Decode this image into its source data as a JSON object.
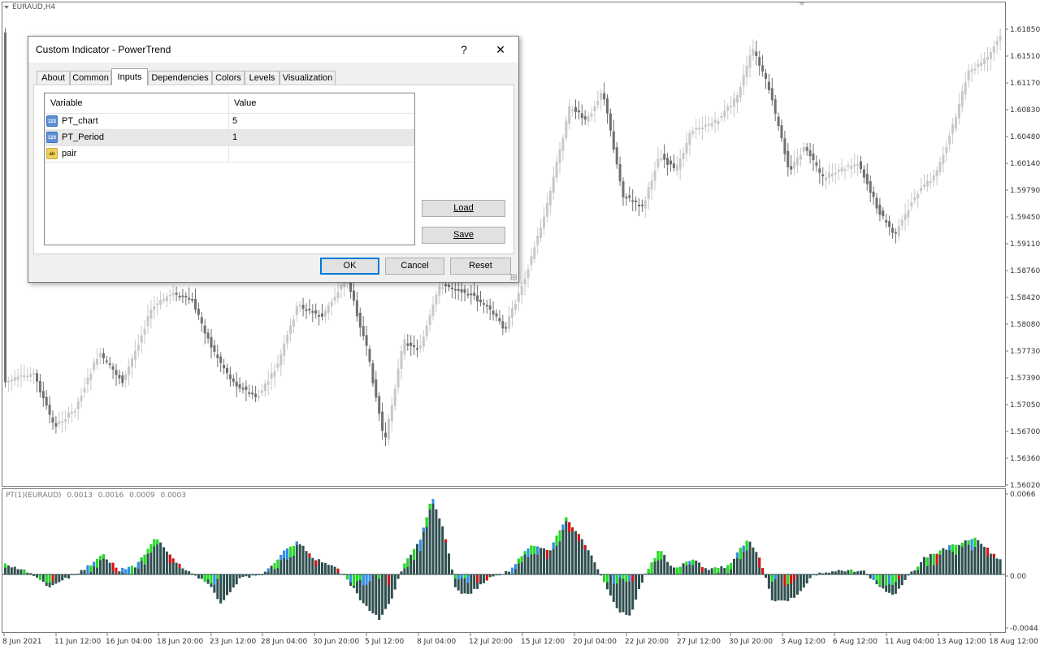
{
  "chart": {
    "symbol_label": "EURAUD,H4",
    "price_ticks": [
      "1.61850",
      "1.61510",
      "1.61170",
      "1.60830",
      "1.60480",
      "1.60140",
      "1.59790",
      "1.59450",
      "1.59110",
      "1.58760",
      "1.58420",
      "1.58080",
      "1.57730",
      "1.57390",
      "1.57050",
      "1.56700",
      "1.56360",
      "1.56020"
    ],
    "time_ticks": [
      "8 Jun 2021",
      "11 Jun 12:00",
      "16 Jun 04:00",
      "18 Jun 20:00",
      "23 Jun 12:00",
      "28 Jun 04:00",
      "30 Jun 20:00",
      "5 Jul 12:00",
      "8 Jul 04:00",
      "12 Jul 20:00",
      "15 Jul 12:00",
      "20 Jul 04:00",
      "22 Jul 20:00",
      "27 Jul 12:00",
      "30 Jul 20:00",
      "3 Aug 12:00",
      "6 Aug 12:00",
      "11 Aug 04:00",
      "13 Aug 12:00",
      "18 Aug 12:00"
    ],
    "indicator_label": "PT(1)(EURAUD)",
    "indicator_values": [
      "0.0013",
      "0.0016",
      "0.0009",
      "0.0003"
    ],
    "indicator_ticks": [
      "0.0066",
      "0.00",
      "-0.0044"
    ],
    "colors": {
      "candle_bull": "#c8c8c8",
      "candle_bear": "#707070",
      "hist_base": "#2f4f4f",
      "hist_green": "#1fe01f",
      "hist_blue": "#2f8fef",
      "hist_red": "#e01010"
    }
  },
  "dialog": {
    "title": "Custom Indicator - PowerTrend",
    "help_label": "?",
    "close_label": "✕",
    "tabs": [
      "About",
      "Common",
      "Inputs",
      "Dependencies",
      "Colors",
      "Levels",
      "Visualization"
    ],
    "active_tab": "Inputs",
    "columns": {
      "variable": "Variable",
      "value": "Value"
    },
    "rows": [
      {
        "icon": "123",
        "variable": "PT_chart",
        "value": "5"
      },
      {
        "icon": "123",
        "variable": "PT_Period",
        "value": "1"
      },
      {
        "icon": "ab",
        "variable": "pair",
        "value": ""
      }
    ],
    "load_label": "Load",
    "save_label": "Save",
    "ok_label": "OK",
    "cancel_label": "Cancel",
    "reset_label": "Reset"
  }
}
